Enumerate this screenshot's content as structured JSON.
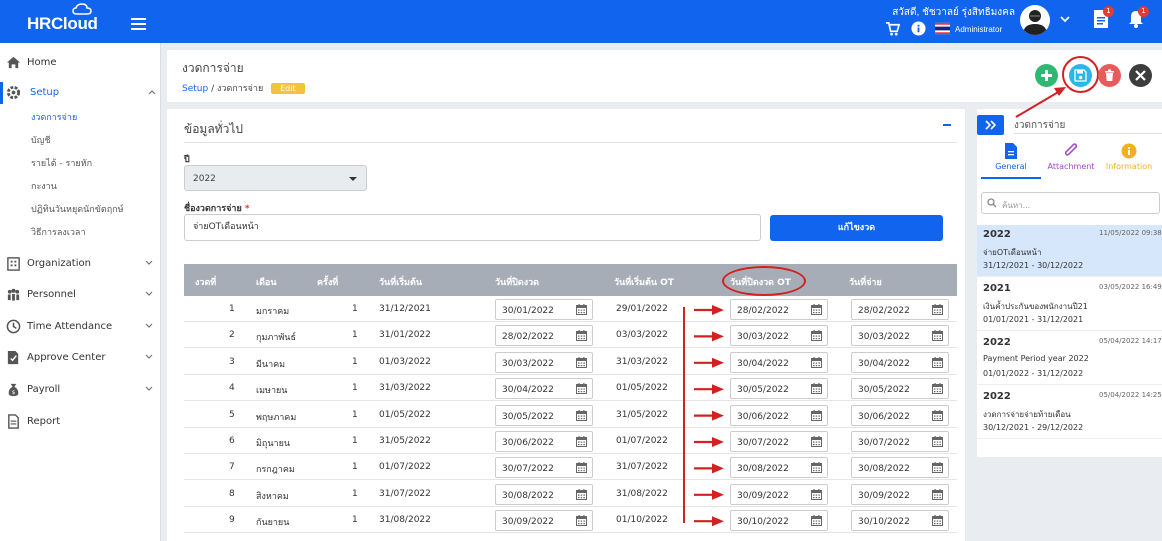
{
  "app": {
    "logo": "HRCloud"
  },
  "user": {
    "name": "สวัสดี, ชัชวาลย์ รุ่งสิทธิมงคล",
    "role": "Administrator"
  },
  "badges": {
    "docs": "1",
    "bell": "1"
  },
  "sidebar": {
    "home": "Home",
    "setup": "Setup",
    "setup_sub": [
      "งวดการจ่าย",
      "บัญชี",
      "รายได้ - รายหัก",
      "กะงาน",
      "ปฏิทินวันหยุดนักขัตฤกษ์",
      "วิธีการลงเวลา"
    ],
    "organization": "Organization",
    "personnel": "Personnel",
    "time_attendance": "Time Attendance",
    "approve_center": "Approve Center",
    "payroll": "Payroll",
    "report": "Report"
  },
  "header": {
    "title": "งวดการจ่าย",
    "crumb_setup": "Setup",
    "crumb_sep": "/",
    "crumb_current": "งวดการจ่าย",
    "edit_badge": "Edit"
  },
  "section": {
    "title": "ข้อมูลทั่วไป"
  },
  "form": {
    "year_label": "ปี",
    "year_value": "2022",
    "name_label": "ชื่องวดการจ่าย",
    "name_required": "*",
    "name_value": "จ่ายOTเดือนหน้า",
    "generate_button": "แก้ไขงวด"
  },
  "table": {
    "headers": [
      "งวดที่",
      "เดือน",
      "ครั้งที่",
      "วันที่เริ่มต้น",
      "วันที่ปิดงวด",
      "วันที่เริ่มต้น OT",
      "วันที่ปิดงวด OT",
      "วันที่จ่าย"
    ],
    "rows": [
      {
        "no": "1",
        "month": "มกราคม",
        "times": "1",
        "start": "31/12/2021",
        "close": "30/01/2022",
        "ot_start": "29/01/2022",
        "ot_close": "28/02/2022",
        "pay": "28/02/2022"
      },
      {
        "no": "2",
        "month": "กุมภาพันธ์",
        "times": "1",
        "start": "31/01/2022",
        "close": "28/02/2022",
        "ot_start": "03/03/2022",
        "ot_close": "30/03/2022",
        "pay": "30/03/2022"
      },
      {
        "no": "3",
        "month": "มีนาคม",
        "times": "1",
        "start": "01/03/2022",
        "close": "30/03/2022",
        "ot_start": "31/03/2022",
        "ot_close": "30/04/2022",
        "pay": "30/04/2022"
      },
      {
        "no": "4",
        "month": "เมษายน",
        "times": "1",
        "start": "31/03/2022",
        "close": "30/04/2022",
        "ot_start": "01/05/2022",
        "ot_close": "30/05/2022",
        "pay": "30/05/2022"
      },
      {
        "no": "5",
        "month": "พฤษภาคม",
        "times": "1",
        "start": "01/05/2022",
        "close": "30/05/2022",
        "ot_start": "31/05/2022",
        "ot_close": "30/06/2022",
        "pay": "30/06/2022"
      },
      {
        "no": "6",
        "month": "มิถุนายน",
        "times": "1",
        "start": "31/05/2022",
        "close": "30/06/2022",
        "ot_start": "01/07/2022",
        "ot_close": "30/07/2022",
        "pay": "30/07/2022"
      },
      {
        "no": "7",
        "month": "กรกฎาคม",
        "times": "1",
        "start": "01/07/2022",
        "close": "30/07/2022",
        "ot_start": "31/07/2022",
        "ot_close": "30/08/2022",
        "pay": "30/08/2022"
      },
      {
        "no": "8",
        "month": "สิงหาคม",
        "times": "1",
        "start": "31/07/2022",
        "close": "30/08/2022",
        "ot_start": "31/08/2022",
        "ot_close": "30/09/2022",
        "pay": "30/09/2022"
      },
      {
        "no": "9",
        "month": "กันยายน",
        "times": "1",
        "start": "31/08/2022",
        "close": "30/09/2022",
        "ot_start": "01/10/2022",
        "ot_close": "30/10/2022",
        "pay": "30/10/2022"
      }
    ]
  },
  "right_panel": {
    "title": "งวดการจ่าย",
    "tabs": [
      "General",
      "Attachment",
      "Information"
    ],
    "search_placeholder": "ค้นหา...",
    "items": [
      {
        "year": "2022",
        "stamp": "11/05/2022 09:38",
        "name": "จ่ายOTเดือนหน้า",
        "range": "31/12/2021 - 30/12/2022"
      },
      {
        "year": "2021",
        "stamp": "03/05/2022 16:49",
        "name": "เงินค้ำประกันของพนักงานปี21",
        "range": "01/01/2021 - 31/12/2021"
      },
      {
        "year": "2022",
        "stamp": "05/04/2022 14:17",
        "name": "Payment Period year 2022",
        "range": "01/01/2022 - 31/12/2022"
      },
      {
        "year": "2022",
        "stamp": "05/04/2022 14:25",
        "name": "งวดการจ่ายจ่ายท้ายเดือน",
        "range": "30/12/2021 - 29/12/2022"
      }
    ]
  },
  "colors": {
    "primary": "#1164ee",
    "add": "#2eb872",
    "save": "#29b6e8",
    "delete": "#e75b5b",
    "close": "#3d3d3d",
    "annotation": "#d32020",
    "edit_badge": "#f3c33b",
    "info_tab": "#f2b01e",
    "attach_tab": "#a044c8"
  },
  "icons": [
    "cart-icon",
    "info-icon",
    "thailand-flag-icon",
    "document-icon",
    "bell-icon",
    "home-icon",
    "gear-icon",
    "organization-icon",
    "personnel-icon",
    "clock-icon",
    "approve-icon",
    "money-bag-icon",
    "report-icon",
    "plus-icon",
    "save-icon",
    "trash-icon",
    "close-icon",
    "calendar-icon",
    "double-chevron-icon",
    "file-icon",
    "paperclip-icon",
    "information-icon",
    "search-icon"
  ]
}
